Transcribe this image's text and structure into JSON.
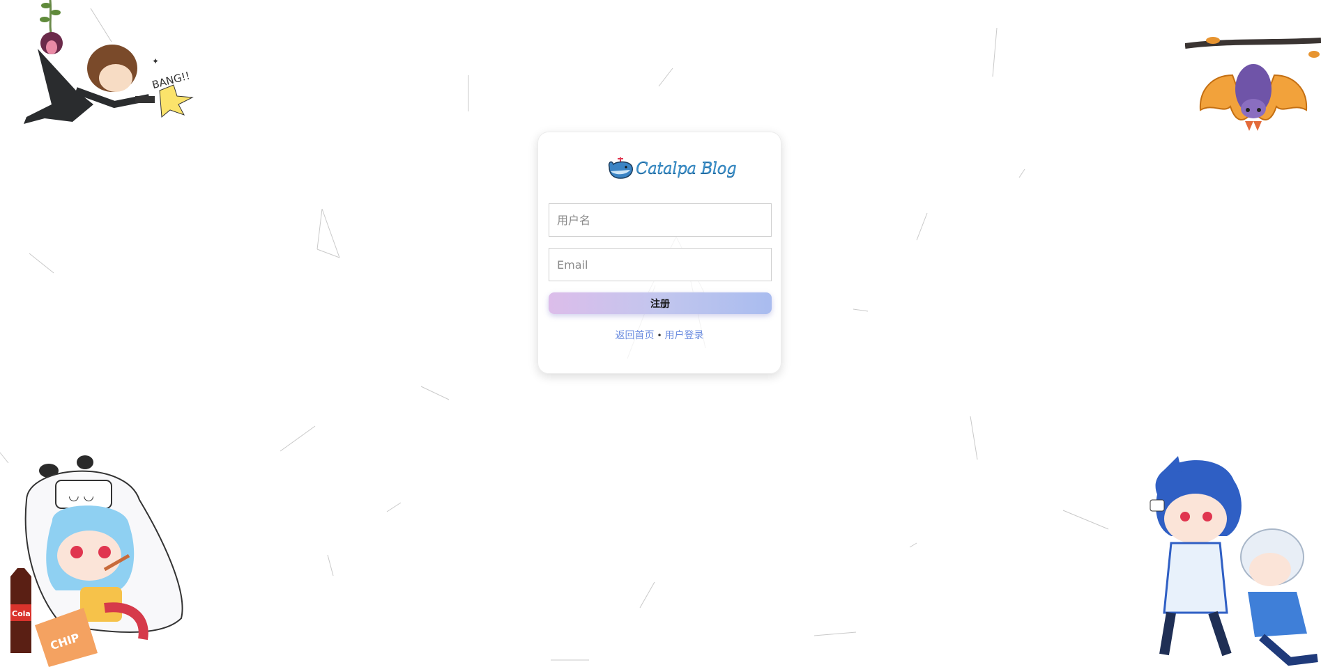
{
  "brand": {
    "name": "Catalpa Blog",
    "logo_icon": "whale-icon"
  },
  "form": {
    "username_placeholder": "用户名",
    "email_placeholder": "Email",
    "submit_label": "注册"
  },
  "links": {
    "home": "返回首页",
    "separator": "•",
    "login": "用户登录"
  },
  "decorations": {
    "top_left": {
      "icon": "gunner-character-icon",
      "text": "BANG!!"
    },
    "top_right": {
      "icon": "hanging-bat-icon"
    },
    "bottom_left": {
      "icon": "snack-girl-icon",
      "cola_label": "Cola",
      "chips_label": "CHIP"
    },
    "bottom_right": {
      "icon": "running-boys-icon"
    }
  }
}
